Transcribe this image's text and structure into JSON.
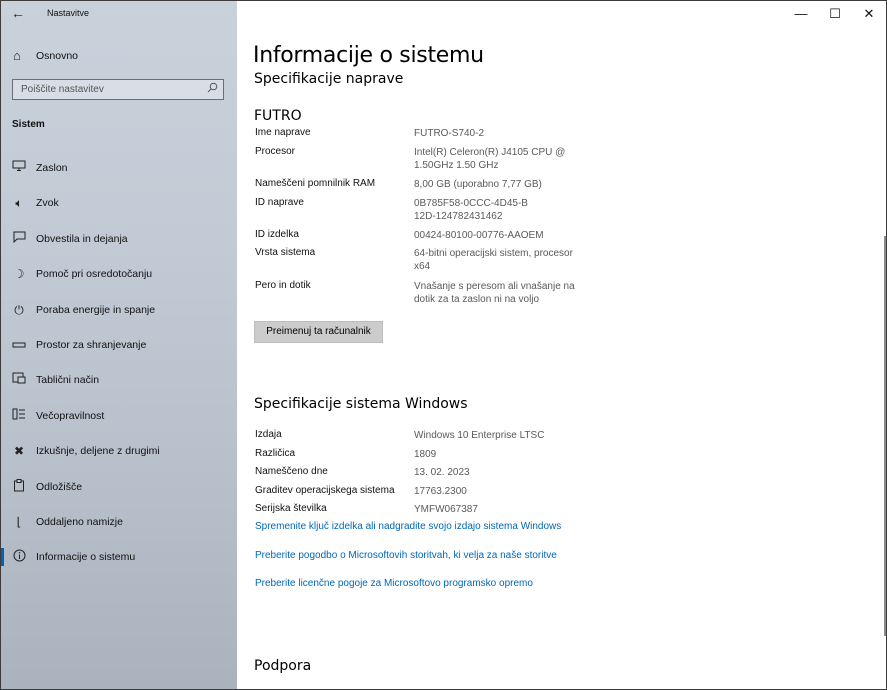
{
  "app": {
    "title": "Nastavitve"
  },
  "window_controls": {
    "minimize": "—",
    "maximize": "☐",
    "close": "✕"
  },
  "sidebar": {
    "home_label": "Osnovno",
    "search_placeholder": "Poiščite nastavitev",
    "section_title": "Sistem",
    "items": [
      {
        "label": "Zaslon",
        "icon": "monitor-icon"
      },
      {
        "label": "Zvok",
        "icon": "speaker-icon"
      },
      {
        "label": "Obvestila in dejanja",
        "icon": "notification-icon"
      },
      {
        "label": "Pomoč pri osredotočanju",
        "icon": "moon-icon"
      },
      {
        "label": "Poraba energije in spanje",
        "icon": "power-icon"
      },
      {
        "label": "Prostor za shranjevanje",
        "icon": "storage-icon"
      },
      {
        "label": "Tablični način",
        "icon": "tablet-icon"
      },
      {
        "label": "Večopravilnost",
        "icon": "multitask-icon"
      },
      {
        "label": "Izkušnje, deljene z drugimi",
        "icon": "share-icon"
      },
      {
        "label": "Odložišče",
        "icon": "clipboard-icon"
      },
      {
        "label": "Oddaljeno namizje",
        "icon": "remote-icon"
      },
      {
        "label": "Informacije o sistemu",
        "icon": "info-icon",
        "active": true
      }
    ]
  },
  "main": {
    "title": "Informacije o sistemu",
    "device_spec_title": "Specifikacije naprave",
    "device_brand": "FUTRO",
    "device_specs": [
      {
        "key": "Ime naprave",
        "value": "FUTRO-S740-2"
      },
      {
        "key": "Procesor",
        "value": "Intel(R) Celeron(R) J4105 CPU @ 1.50GHz   1.50 GHz"
      },
      {
        "key": "Nameščeni pomnilnik RAM",
        "value": "8,00 GB (uporabno 7,77 GB)"
      },
      {
        "key": "ID naprave",
        "value": "0B785F58-0CCC-4D45-B12D-124782431462"
      },
      {
        "key": "ID izdelka",
        "value": "00424-80100-00776-AAOEM"
      },
      {
        "key": "Vrsta sistema",
        "value": "64-bitni operacijski sistem, procesor x64"
      },
      {
        "key": "Pero in dotik",
        "value": "Vnašanje s peresom ali vnašanje na dotik za ta zaslon ni na voljo"
      }
    ],
    "rename_button": "Preimenuj ta računalnik",
    "windows_spec_title": "Specifikacije sistema Windows",
    "windows_specs": [
      {
        "key": "Izdaja",
        "value": "Windows 10 Enterprise LTSC"
      },
      {
        "key": "Različica",
        "value": "1809"
      },
      {
        "key": "Nameščeno dne",
        "value": "13. 02. 2023"
      },
      {
        "key": "Graditev operacijskega sistema",
        "value": "17763.2300"
      },
      {
        "key": "Serijska številka",
        "value": "YMFW067387"
      }
    ],
    "links": [
      "Spremenite ključ izdelka ali nadgradite svojo izdajo sistema Windows",
      "Preberite pogodbo o Microsoftovih storitvah, ki velja za naše storitve",
      "Preberite licenčne pogoje za Microsoftovo programsko opremo"
    ],
    "support_title": "Podpora"
  }
}
